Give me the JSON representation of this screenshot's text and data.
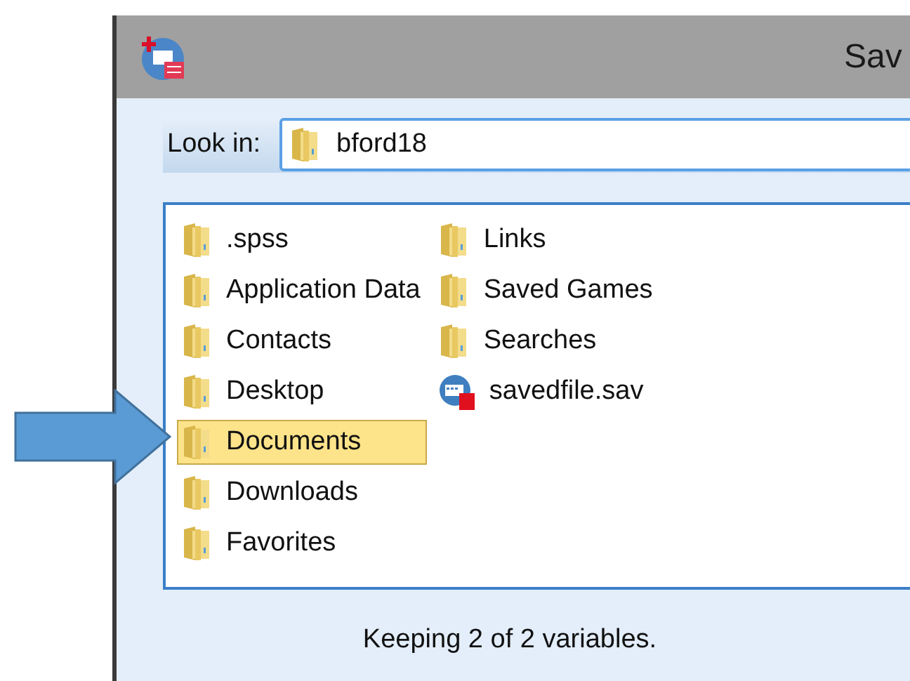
{
  "window": {
    "title": "Sav"
  },
  "look_in": {
    "label": "Look in:",
    "value": "bford18"
  },
  "files": [
    {
      "name": ".spss",
      "kind": "folder",
      "selected": false
    },
    {
      "name": "Application Data",
      "kind": "folder",
      "selected": false
    },
    {
      "name": "Contacts",
      "kind": "folder",
      "selected": false
    },
    {
      "name": "Desktop",
      "kind": "folder",
      "selected": false
    },
    {
      "name": "Documents",
      "kind": "folder",
      "selected": true
    },
    {
      "name": "Downloads",
      "kind": "folder",
      "selected": false
    },
    {
      "name": "Favorites",
      "kind": "folder",
      "selected": false
    },
    {
      "name": "Links",
      "kind": "folder",
      "selected": false
    },
    {
      "name": "Saved Games",
      "kind": "folder",
      "selected": false
    },
    {
      "name": "Searches",
      "kind": "folder",
      "selected": false
    },
    {
      "name": "savedfile.sav",
      "kind": "datafile",
      "selected": false
    }
  ],
  "status": "Keeping 2 of 2 variables."
}
